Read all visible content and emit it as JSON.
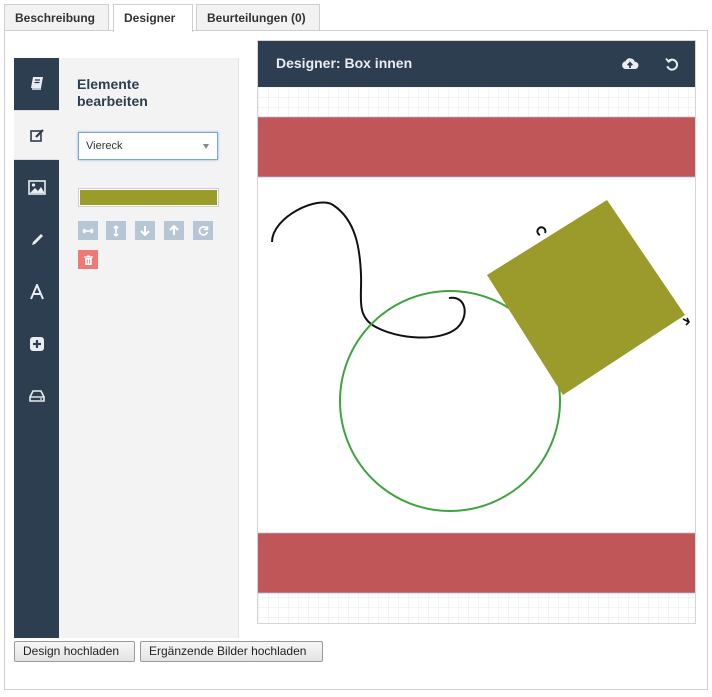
{
  "tabs": [
    {
      "label": "Beschreibung"
    },
    {
      "label": "Designer"
    },
    {
      "label": "Beurteilungen (0)"
    }
  ],
  "sidebar": {
    "tools": [
      "book-icon",
      "edit-icon",
      "image-icon",
      "pencil-icon",
      "text-icon",
      "add-icon",
      "hdd-icon"
    ],
    "active_tool": "edit-icon"
  },
  "edit_panel": {
    "title": "Elemente bearbeiten",
    "shape_select": {
      "value": "Viereck"
    },
    "fill_color": "#9a9b2b",
    "action_icons": [
      "arrows-h-icon",
      "arrows-v-icon",
      "arrow-down-icon",
      "arrow-up-icon",
      "refresh-icon",
      "trash-icon"
    ]
  },
  "designer": {
    "title": "Designer: Box innen",
    "header_icons": [
      "cloud-upload-icon",
      "undo-icon"
    ]
  },
  "colors": {
    "navy": "#2d3e50",
    "band_red": "#c15658",
    "square_olive": "#9a9b2b",
    "circle_green": "#3fa33f",
    "curve_black": "#111111"
  },
  "buttons": {
    "design_upload": "Design hochladen",
    "extra_images_upload": "Ergänzende Bilder hochladen"
  }
}
